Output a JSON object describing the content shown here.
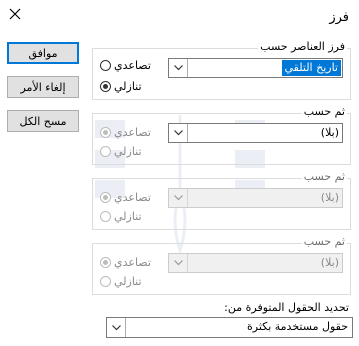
{
  "window": {
    "title": "فرز"
  },
  "buttons": {
    "ok": "موافق",
    "cancel": "إلغاء الأمر",
    "clear_all": "مسح الكل"
  },
  "sort_by": {
    "label": "فرز العناصر حسب",
    "value": "تاريخ التلقي",
    "ascending": "تصاعدي",
    "descending": "تنازلي",
    "selected": "descending"
  },
  "then_by_1": {
    "label": "ثم حسب",
    "value": "(بلا)",
    "ascending": "تصاعدي",
    "descending": "تنازلي"
  },
  "then_by_2": {
    "label": "ثم حسب",
    "value": "(بلا)",
    "ascending": "تصاعدي",
    "descending": "تنازلي"
  },
  "then_by_3": {
    "label": "ثم حسب",
    "value": "(بلا)",
    "ascending": "تصاعدي",
    "descending": "تنازلي"
  },
  "fields_from": {
    "label": "تحديد الحقول المتوفرة من:",
    "value": "حقول مستخدمة بكثرة"
  }
}
